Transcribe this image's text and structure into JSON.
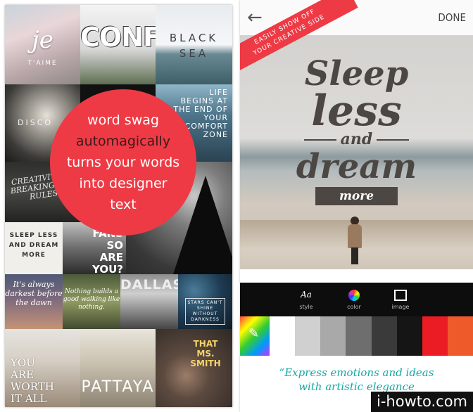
{
  "left_screen": {
    "promo": {
      "line1": "word swag",
      "line2": "automagically",
      "line3": "turns your words",
      "line4": "into designer",
      "line5": "text"
    },
    "tiles": {
      "t1_script": "je",
      "t1_small": "T'AIME",
      "t2": "CONF",
      "t3_line1": "BLACK",
      "t3_line2": "SEA",
      "t4": "DISCO",
      "t5": "LIFE BEGINS AT THE END OF YOUR COMFORT ZONE",
      "t6": "CREATIVITY IS BREAKING THE RULES",
      "t8_line1": "SLEEP LESS",
      "t8_line2": "AND DREAM MORE",
      "t9": "FANS SO ARE YOU?",
      "t10": "It's always darkest before the dawn",
      "t11": "Nothing builds a good walking like nothing.",
      "t12": "DALLAS",
      "t13": "STARS CAN'T SHINE WITHOUT DARKNESS",
      "t14_line1": "YOU",
      "t14_line2": "ARE",
      "t14_line3": "WORTH",
      "t14_line4": "IT ALL",
      "t15": "PATTAYA",
      "t16": "THAT MS. SMITH"
    }
  },
  "right_screen": {
    "back_icon": "arrow-left-icon",
    "done_label": "DONE",
    "ribbon_line1": "EASILY SHOW OFF",
    "ribbon_line2": "YOUR CREATIVE SIDE",
    "quote": {
      "line1": "Sleep",
      "line2": "less",
      "line3": "and",
      "line4": "dream",
      "line5": "more"
    },
    "toolbar": {
      "style_label": "style",
      "color_label": "color",
      "image_label": "image",
      "style_icon_text": "Aa"
    },
    "swatches": [
      "#ffffff",
      "#d0d0d0",
      "#a9a9a9",
      "#6e6e6e",
      "#3a3a3a",
      "#151515",
      "#ec1c24",
      "#ef5a2b"
    ],
    "tagline_line1": "“Express emotions and ideas",
    "tagline_line2": "with artistic elegance"
  },
  "watermark": "i-howto.com"
}
